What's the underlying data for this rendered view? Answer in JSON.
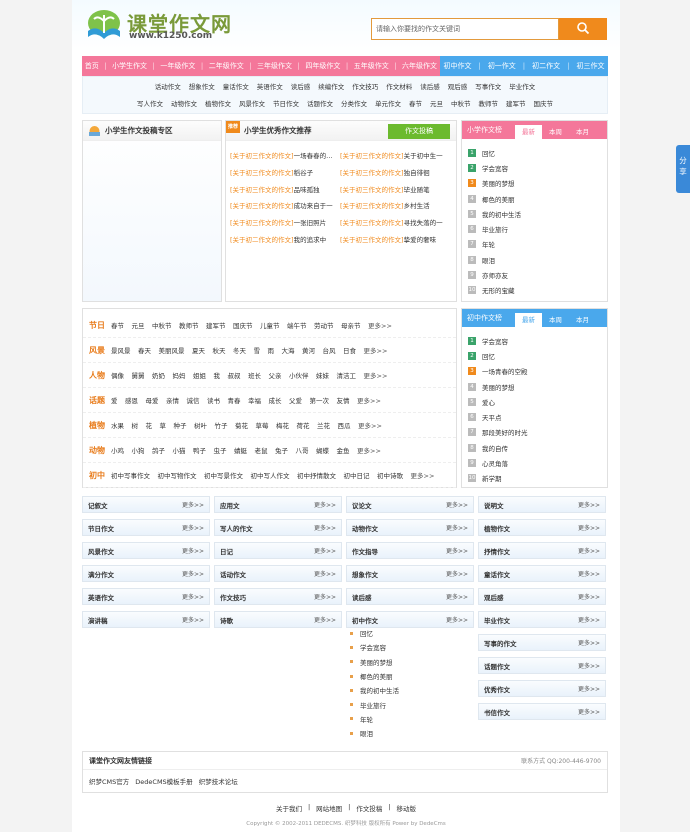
{
  "header": {
    "logo_title": "课堂作文网",
    "logo_url": "www.k1250.com",
    "search_placeholder": "请输入你要找的作文关键词"
  },
  "nav": {
    "left": [
      "首页",
      "小学生作文",
      "一年级作文",
      "二年级作文",
      "三年级作文",
      "四年级作文",
      "五年级作文",
      "六年级作文"
    ],
    "right": [
      "初中作文",
      "初一作文",
      "初二作文",
      "初三作文"
    ]
  },
  "subnav": {
    "row1": [
      "话动作文",
      "想象作文",
      "童话作文",
      "英语作文",
      "读后感",
      "续编作文",
      "作文技巧",
      "作文材料",
      "读后感",
      "观后感",
      "写事作文",
      "毕业作文"
    ],
    "row2": [
      "写人作文",
      "动物作文",
      "植物作文",
      "风景作文",
      "节日作文",
      "话题作文",
      "分类作文",
      "单元作文",
      "春节",
      "元旦",
      "中秋节",
      "教师节",
      "建军节",
      "国庆节"
    ]
  },
  "zone": {
    "title": "小学生作文投稿专区"
  },
  "rec": {
    "title": "小学生优秀作文推荐",
    "badge": "推荐",
    "btn": "作文投稿",
    "rows": [
      [
        "[关于初三作文的作文]",
        "一场春春的…",
        "[关于初三作文的作文]",
        "关于初中生一"
      ],
      [
        "[关于初三作文的作文]",
        "稻谷子",
        "[关于初三作文的作文]",
        "独自徘徊"
      ],
      [
        "[关于初三作文的作文]",
        "品味孤独",
        "[关于初三作文的作文]",
        "毕业随笔"
      ],
      [
        "[关于初三作文的作文]",
        "成功来自于一",
        "[关于初三作文的作文]",
        "乡村生活"
      ],
      [
        "[关于初三作文的作文]",
        "一张旧照片",
        "[关于初三作文的作文]",
        "寻找失落的一"
      ],
      [
        "[关于初二作文的作文]",
        "我的追求中",
        "[关于初三作文的作文]",
        "挚爱的奢味"
      ]
    ]
  },
  "xs_rank": {
    "title": "小学作文榜",
    "tabs": [
      "最新",
      "本周",
      "本月"
    ],
    "items": [
      "回忆",
      "学会宽容",
      "美丽的梦想",
      "椰色的美丽",
      "我的初中生活",
      "毕业旅行",
      "年轮",
      "眼泪",
      "亦师亦友",
      "无形的宝藏"
    ]
  },
  "cz_rank": {
    "title": "初中作文榜",
    "tabs": [
      "最新",
      "本周",
      "本月"
    ],
    "items": [
      "学会宽容",
      "回忆",
      "一场青春的空殿",
      "美丽的梦想",
      "爱心",
      "天平点",
      "那段美好的时光",
      "我的自传",
      "心灵角落",
      "新学期"
    ]
  },
  "cats": [
    {
      "name": "节日",
      "items": [
        "春节",
        "元旦",
        "中秋节",
        "教师节",
        "建军节",
        "国庆节",
        "儿童节",
        "端午节",
        "劳动节",
        "母亲节"
      ]
    },
    {
      "name": "风景",
      "items": [
        "景风景",
        "春天",
        "美丽风景",
        "夏天",
        "秋天",
        "冬天",
        "雪",
        "雨",
        "大海",
        "黄河",
        "台风",
        "日食"
      ]
    },
    {
      "name": "人物",
      "items": [
        "偶像",
        "舅舅",
        "奶奶",
        "妈妈",
        "姐姐",
        "我",
        "叔叔",
        "班长",
        "父亲",
        "小伙伴",
        "妹妹",
        "清洁工"
      ]
    },
    {
      "name": "话题",
      "items": [
        "爱",
        "感恩",
        "母爱",
        "亲情",
        "诚信",
        "读书",
        "青春",
        "幸福",
        "成长",
        "父爱",
        "第一次",
        "友情"
      ]
    },
    {
      "name": "植物",
      "items": [
        "水果",
        "树",
        "花",
        "草",
        "种子",
        "树叶",
        "竹子",
        "菊花",
        "草莓",
        "梅花",
        "荷花",
        "兰花",
        "西瓜"
      ]
    },
    {
      "name": "动物",
      "items": [
        "小鸡",
        "小狗",
        "鸽子",
        "小猫",
        "鸭子",
        "虫子",
        "蜻蜓",
        "老鼠",
        "兔子",
        "八哥",
        "蝴蝶",
        "金鱼"
      ]
    },
    {
      "name": "初中",
      "items": [
        "初中写事作文",
        "初中写物作文",
        "初中写景作文",
        "初中写人作文",
        "初中抒情散文",
        "初中日记",
        "初中诗歌"
      ]
    }
  ],
  "more_label": "更多>>",
  "grid": {
    "col1": [
      "记叙文",
      "节日作文",
      "风景作文",
      "满分作文",
      "英语作文",
      "演讲稿"
    ],
    "col2": [
      "应用文",
      "写人的作文",
      "日记",
      "话动作文",
      "作文技巧",
      "诗歌"
    ],
    "col3": [
      "议论文",
      "动物作文",
      "作文指导",
      "想象作文",
      "读后感",
      "初中作文"
    ],
    "col4": [
      "说明文",
      "植物作文",
      "抒情作文",
      "童话作文",
      "观后感",
      "毕业作文",
      "写事的作文",
      "话题作文",
      "优秀作文",
      "书信作文"
    ]
  },
  "jr_list": [
    "回忆",
    "学会宽容",
    "美丽的梦想",
    "椰色的美丽",
    "我的初中生活",
    "毕业旅行",
    "年轮",
    "眼泪"
  ],
  "links": {
    "title": "课堂作文网友情链接",
    "contact": "联系方式 QQ:200-446-9700",
    "items": [
      "织梦CMS官方",
      "DedeCMS模板手册",
      "织梦技术论坛"
    ]
  },
  "footer": {
    "links": [
      "关于我们",
      "网站地图",
      "作文投稿",
      "移动版"
    ],
    "copy": "Copyright © 2002-2011 DEDECMS. 织梦科技 版权所有 Power by DedeCms"
  },
  "share": "分享",
  "colors": {
    "nav_left": "#f4779a",
    "nav_right": "#4aa8ec",
    "accent": "#f08a1c",
    "green": "#6cba2e"
  }
}
